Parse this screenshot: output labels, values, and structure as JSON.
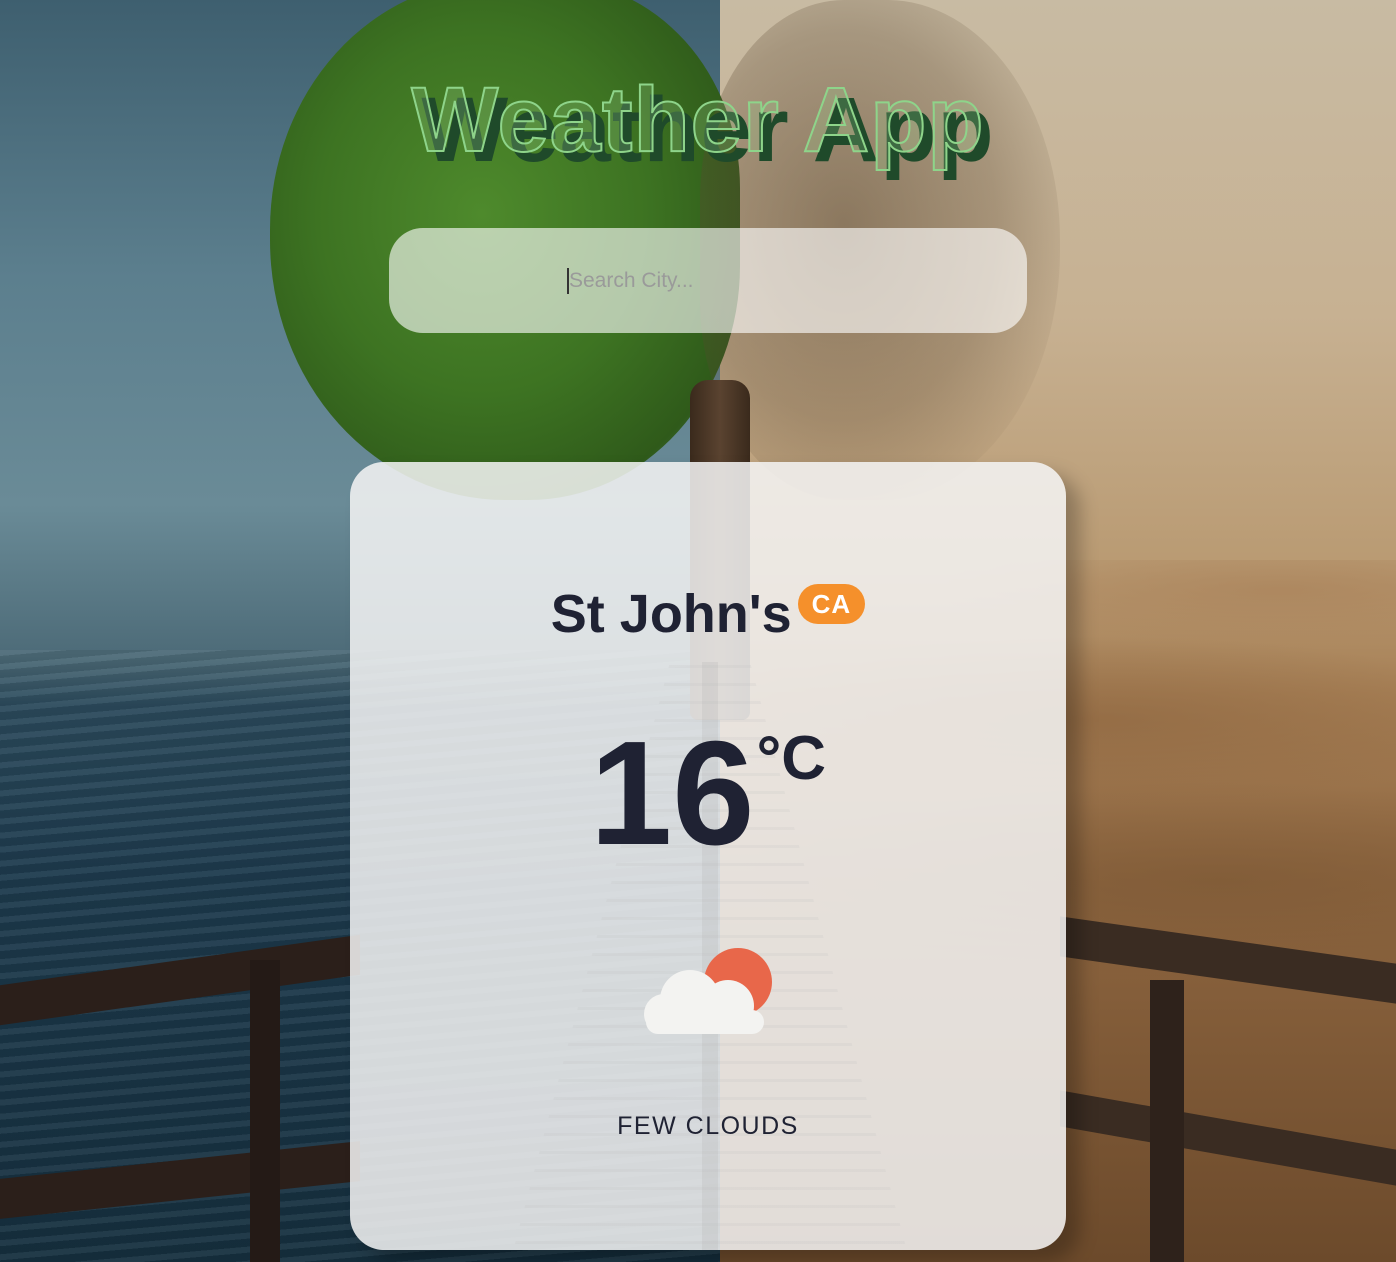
{
  "app": {
    "title": "Weather App"
  },
  "search": {
    "placeholder": "Search City...",
    "value": ""
  },
  "weather": {
    "city": "St John's",
    "country": "CA",
    "temperature": "16",
    "unit": "°C",
    "description": "FEW CLOUDS",
    "icon": "few-clouds-day-icon"
  },
  "colors": {
    "badge": "#f5902b",
    "sun": "#e8674a",
    "text": "#1f2233",
    "title_stroke": "#8ed48a"
  }
}
